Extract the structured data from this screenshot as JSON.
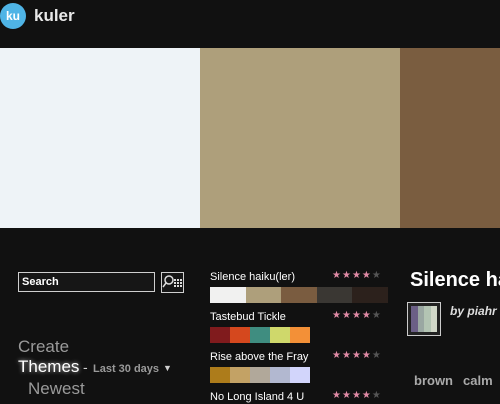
{
  "header": {
    "logo": "ku",
    "title": "kuler"
  },
  "preview_swatches": [
    "#eef3f7",
    "#ae9f7b",
    "#7a5d40"
  ],
  "preview_widths_note": null,
  "search": {
    "value": "Search",
    "button_icon": "search-grid-icon"
  },
  "nav": {
    "create": "Create",
    "themes": "Themes",
    "dash": "-",
    "filter": "Last 30 days",
    "caret": "▼",
    "newest": "Newest"
  },
  "themes": [
    {
      "name": "Silence haiku(ler)",
      "rating": 4,
      "stars": "★★★★★",
      "colors": [
        "#f1f1f0",
        "#ae9f7b",
        "#7a5c40",
        "#3a3733",
        "#2c211c"
      ]
    },
    {
      "name": "Tastebud Tickle",
      "rating": 4,
      "stars": "★★★★★",
      "colors": [
        "#801b1d",
        "#d5481e",
        "#3f8d80",
        "#cfd86b",
        "#f39037"
      ]
    },
    {
      "name": "Rise above the Fray",
      "rating": 4,
      "stars": "★★★★★",
      "colors": [
        "#ad7c1b",
        "#c3a265",
        "#b1a89a",
        "#b2b8d0",
        "#d2d5fb"
      ]
    },
    {
      "name": "No Long Island 4 U",
      "rating": 4,
      "stars": "★★★★★",
      "colors": []
    }
  ],
  "detail": {
    "title": "Silence haiku(ler)",
    "by_prefix": "by",
    "author": "piahr",
    "thumb_colors": [
      "#6b5f86",
      "#9aa7a2",
      "#b3c4b3",
      "#d1d7c8"
    ],
    "tags": [
      "brown",
      "calm"
    ]
  }
}
